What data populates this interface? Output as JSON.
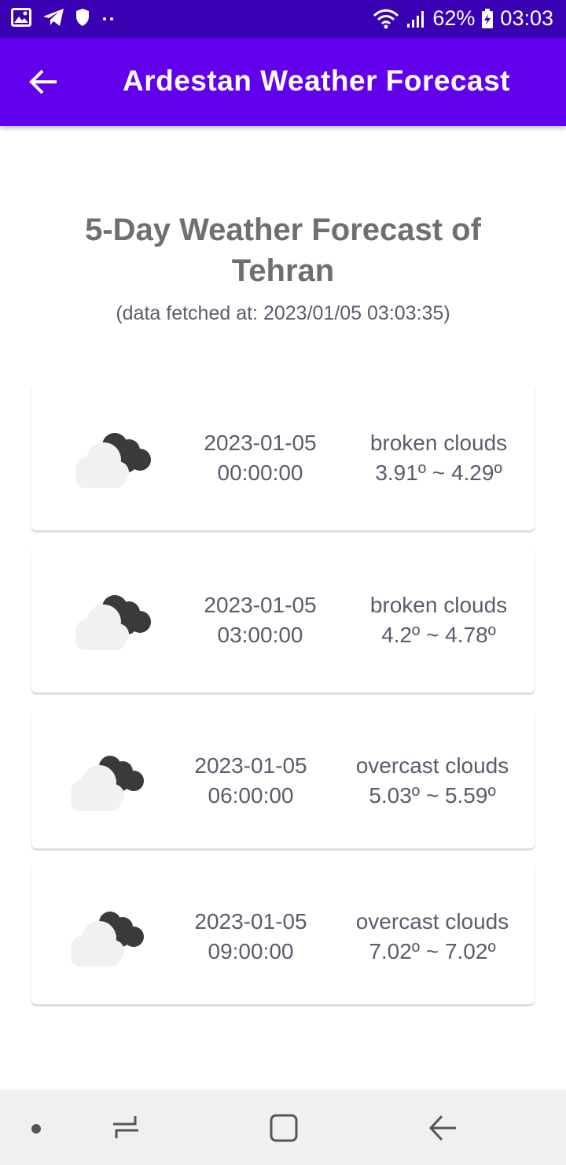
{
  "status_bar": {
    "battery_percent": "62%",
    "time": "03:03"
  },
  "app_bar": {
    "title": "Ardestan Weather Forecast"
  },
  "heading": {
    "title": "5-Day Weather Forecast of Tehran",
    "fetched_at": "(data fetched at: 2023/01/05 03:03:35)"
  },
  "forecasts": [
    {
      "date": "2023-01-05",
      "time": "00:00:00",
      "description": "broken clouds",
      "temp_range": "3.91º ~ 4.29º",
      "icon": "broken-clouds-icon"
    },
    {
      "date": "2023-01-05",
      "time": "03:00:00",
      "description": "broken clouds",
      "temp_range": "4.2º ~ 4.78º",
      "icon": "broken-clouds-icon"
    },
    {
      "date": "2023-01-05",
      "time": "06:00:00",
      "description": "overcast clouds",
      "temp_range": "5.03º ~ 5.59º",
      "icon": "overcast-clouds-icon"
    },
    {
      "date": "2023-01-05",
      "time": "09:00:00",
      "description": "overcast clouds",
      "temp_range": "7.02º ~ 7.02º",
      "icon": "overcast-clouds-icon"
    }
  ],
  "colors": {
    "status_bar": "#3a00b4",
    "app_bar": "#6200ee",
    "heading_text": "#6f6f6f",
    "card_text": "#5b5b6e",
    "nav_bar": "#f0f0f0"
  }
}
